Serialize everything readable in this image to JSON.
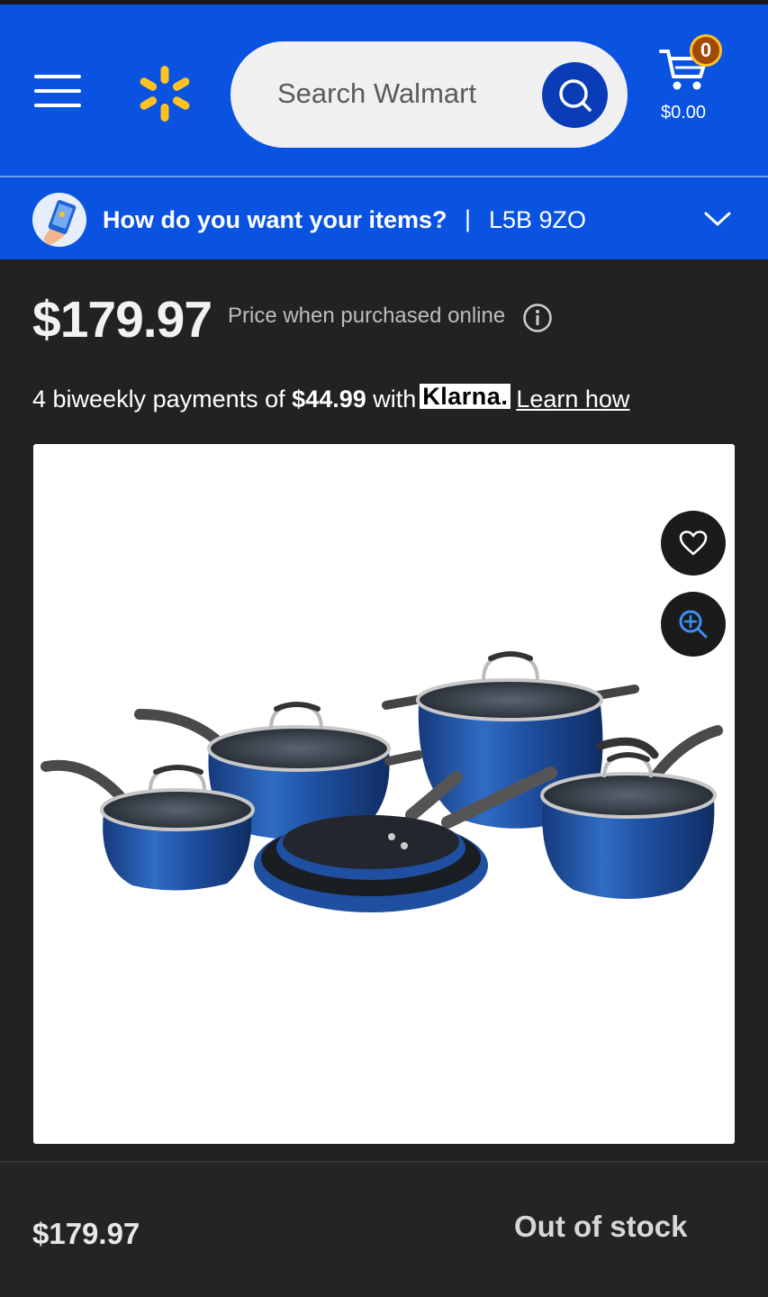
{
  "header": {
    "search_placeholder": "Search Walmart",
    "cart_count": "0",
    "cart_total": "$0.00"
  },
  "delivery": {
    "question": "How do you want your items?",
    "separator": "|",
    "postal_code": "L5B 9ZO"
  },
  "pricing": {
    "price": "$179.97",
    "price_note": "Price when purchased online",
    "klarna_prefix": "4 biweekly payments of",
    "klarna_amount": "$44.99",
    "klarna_with": "with",
    "klarna_logo": "Klarna.",
    "learn_how": "Learn how"
  },
  "bottom_bar": {
    "price": "$179.97",
    "status": "Out of stock"
  },
  "colors": {
    "brand_blue": "#0a53e0",
    "spark_yellow": "#ffc220",
    "pan_blue": "#1f4fa0"
  },
  "icons": {
    "menu": "hamburger-icon",
    "logo": "walmart-spark-icon",
    "search": "search-icon",
    "cart": "cart-icon",
    "chevron": "chevron-down-icon",
    "info": "info-icon",
    "favorite": "heart-icon",
    "zoom": "zoom-in-icon"
  }
}
